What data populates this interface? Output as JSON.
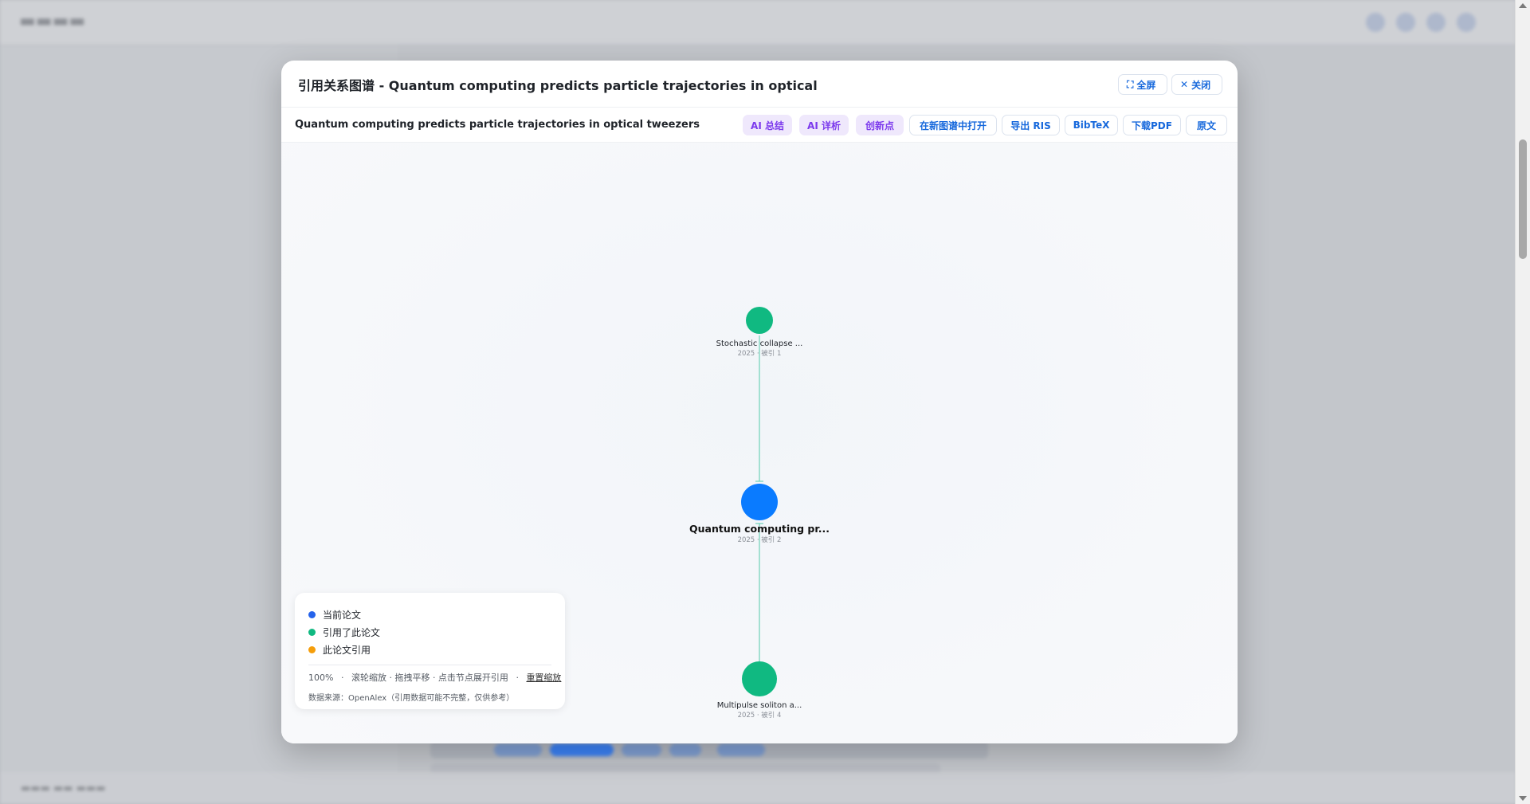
{
  "modal": {
    "title": "引用关系图谱 - Quantum computing predicts particle trajectories in optical",
    "fullscreen_label": "全屏",
    "close_label": "关闭"
  },
  "toolbar": {
    "paper_title": "Quantum computing predicts particle trajectories in optical tweezers",
    "buttons": {
      "ai_summary": "AI 总结",
      "ai_detail": "AI 详析",
      "innovation": "创新点",
      "open_graph": "在新图谱中打开",
      "export_ris": "导出 RIS",
      "bibtex": "BibTeX",
      "download_pdf": "下载PDF",
      "original": "原文"
    }
  },
  "graph": {
    "nodes": [
      {
        "id": "citing-1",
        "label": "Stochastic collapse ...",
        "meta": "2025 · 被引 1",
        "kind": "citing",
        "color": "#10b981"
      },
      {
        "id": "current",
        "label": "Quantum computing pr...",
        "meta": "2025 · 被引 2",
        "kind": "current",
        "color": "#0a7bff"
      },
      {
        "id": "citing-2",
        "label": "Multipulse soliton a...",
        "meta": "2025 · 被引 4",
        "kind": "citing",
        "color": "#10b981"
      }
    ],
    "edge_color": "#6fd2b8"
  },
  "legend": {
    "items": [
      {
        "label": "当前论文",
        "color": "#2563eb"
      },
      {
        "label": "引用了此论文",
        "color": "#10b981"
      },
      {
        "label": "此论文引用",
        "color": "#f59e0b"
      }
    ],
    "zoom": "100%",
    "hint": "滚轮缩放 · 拖拽平移 · 点击节点展开引用",
    "reset": "重置缩放",
    "source": "数据来源：OpenAlex（引用数据可能不完整，仅供参考）"
  }
}
